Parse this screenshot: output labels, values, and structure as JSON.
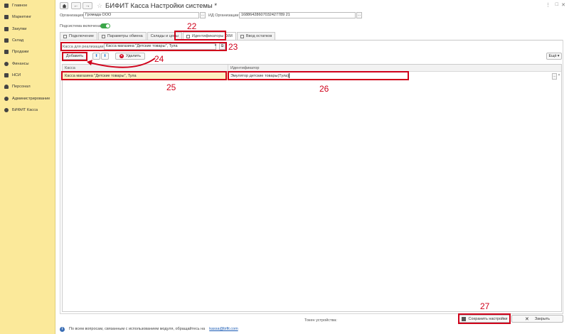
{
  "sidebar": {
    "items": [
      {
        "label": "Главное",
        "icon": "menu-icon"
      },
      {
        "label": "Маркетинг",
        "icon": "chart-icon"
      },
      {
        "label": "Закупки",
        "icon": "cart-icon"
      },
      {
        "label": "Склад",
        "icon": "warehouse-icon"
      },
      {
        "label": "Продажи",
        "icon": "sales-icon"
      },
      {
        "label": "Финансы",
        "icon": "finance-icon"
      },
      {
        "label": "НСИ",
        "icon": "catalog-icon"
      },
      {
        "label": "Персонал",
        "icon": "person-icon"
      },
      {
        "label": "Администрирование",
        "icon": "gear-icon"
      },
      {
        "label": "БИФИТ Касса",
        "icon": "cashbox-icon"
      }
    ]
  },
  "window": {
    "title": "БИФИТ Касса Настройки системы *",
    "back_glyph": "←",
    "forward_glyph": "→",
    "star_glyph": "☆",
    "more_glyph": "⋮",
    "restore_glyph": "□",
    "close_glyph": "✕"
  },
  "form": {
    "org_label": "Организация:",
    "org_value": "Громада ООО",
    "org_id_label": "ИД Организации:",
    "org_id_value": "16886428607032427789 21",
    "subsystem_label": "Подсистема включена:"
  },
  "tabs": [
    {
      "label": "Подключение"
    },
    {
      "label": "Параметры обмена"
    },
    {
      "label": "Склады и цены"
    },
    {
      "label": "Идентификаторы ККМ"
    },
    {
      "label": "Ввод остатков"
    }
  ],
  "filter": {
    "label": "Касса для реализации:",
    "value": "Касса магазина \"Детские товары\", Тула"
  },
  "toolbar": {
    "add_label": "Добавить",
    "up_glyph": "⬆",
    "down_glyph": "⬇",
    "delete_label": "Удалить",
    "more_label": "Ещё"
  },
  "table": {
    "columns": [
      "Касса",
      "Идентификатор"
    ],
    "rows": [
      {
        "kassa": "Касса магазина \"Детские товары\", Тула",
        "id": "Эмулятор детские товары(Тула)"
      }
    ]
  },
  "footer": {
    "token_label": "Токен устройства:",
    "save_label": "Сохранить настройки",
    "close_label": "Закрыть",
    "info_text": "По всем вопросам, связанным с использованием модуля, обращайтесь на",
    "email": "kassa@bifit.com"
  },
  "annotations": [
    "22",
    "23",
    "24",
    "25",
    "26",
    "27"
  ],
  "colors": {
    "sidebar_bg": "#fbe99a",
    "highlight": "#d0021b",
    "row_selected": "#fdf1c2",
    "toggle_on": "#3aa648"
  }
}
